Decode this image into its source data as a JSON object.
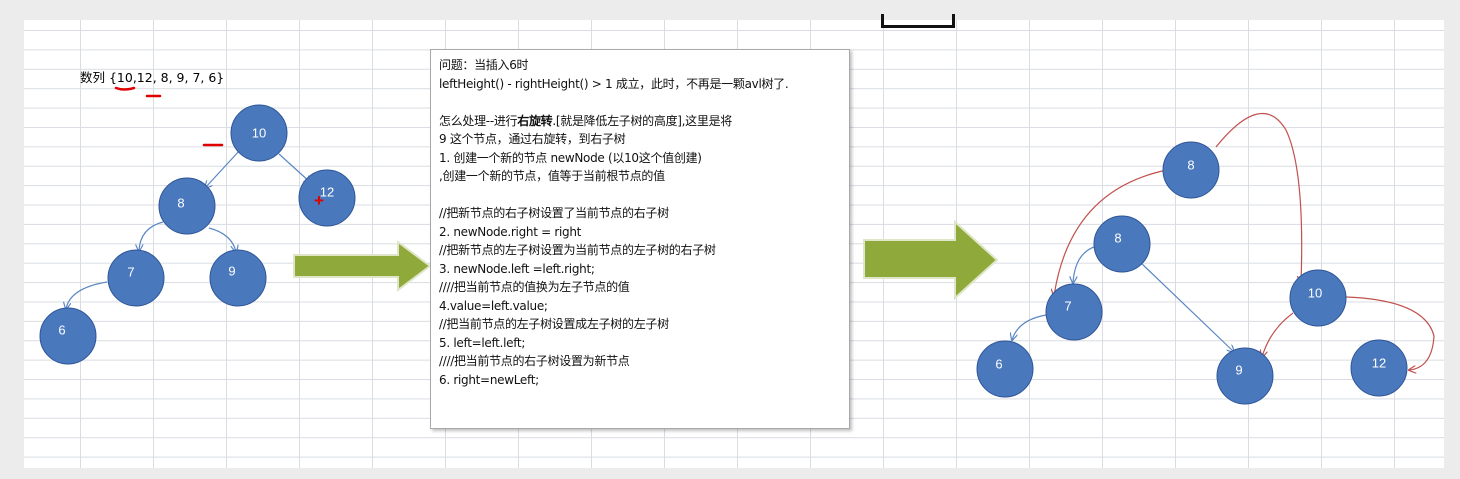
{
  "sequence_label": "数列 {10,12, 8, 9, 7, 6}",
  "left_tree": {
    "nodes": [
      {
        "id": "n10",
        "label": "10"
      },
      {
        "id": "n12",
        "label": "12"
      },
      {
        "id": "n8",
        "label": "8"
      },
      {
        "id": "n9",
        "label": "9"
      },
      {
        "id": "n7",
        "label": "7"
      },
      {
        "id": "n6",
        "label": "6"
      }
    ],
    "plus_mark": "+"
  },
  "text_box": {
    "lines": [
      "问题：当插入6时",
      "leftHeight() - rightHeight() > 1 成立，此时，不再是一颗avl树了.",
      "",
      "怎么处理--进行右旋转.[就是降低左子树的高度],这里是将",
      "9 这个节点，通过右旋转，到右子树",
      "1. 创建一个新的节点 newNode (以10这个值创建)",
      ",创建一个新的节点，值等于当前根节点的值",
      "",
      "//把新节点的右子树设置了当前节点的右子树",
      "2. newNode.right = right",
      "//把新节点的左子树设置为当前节点的左子树的右子树",
      "3. newNode.left =left.right;",
      "////把当前节点的值换为左子节点的值",
      "4.value=left.value;",
      "//把当前节点的左子树设置成左子树的左子树",
      "5. left=left.left;",
      "////把当前节点的右子树设置为新节点",
      "6. right=newLeft;"
    ]
  },
  "right_tree": {
    "nodes": [
      {
        "id": "r8top",
        "label": "8"
      },
      {
        "id": "r8",
        "label": "8"
      },
      {
        "id": "r7",
        "label": "7"
      },
      {
        "id": "r10",
        "label": "10"
      },
      {
        "id": "r6",
        "label": "6"
      },
      {
        "id": "r9",
        "label": "9"
      },
      {
        "id": "r12",
        "label": "12"
      }
    ]
  },
  "colors": {
    "node_fill": "#4a78bd",
    "node_stroke": "#2f5597",
    "edge_blue": "#5b87c4",
    "edge_red": "#c0504d",
    "arrow_fill": "#8faa3b",
    "annotation_red": "#e00000"
  }
}
